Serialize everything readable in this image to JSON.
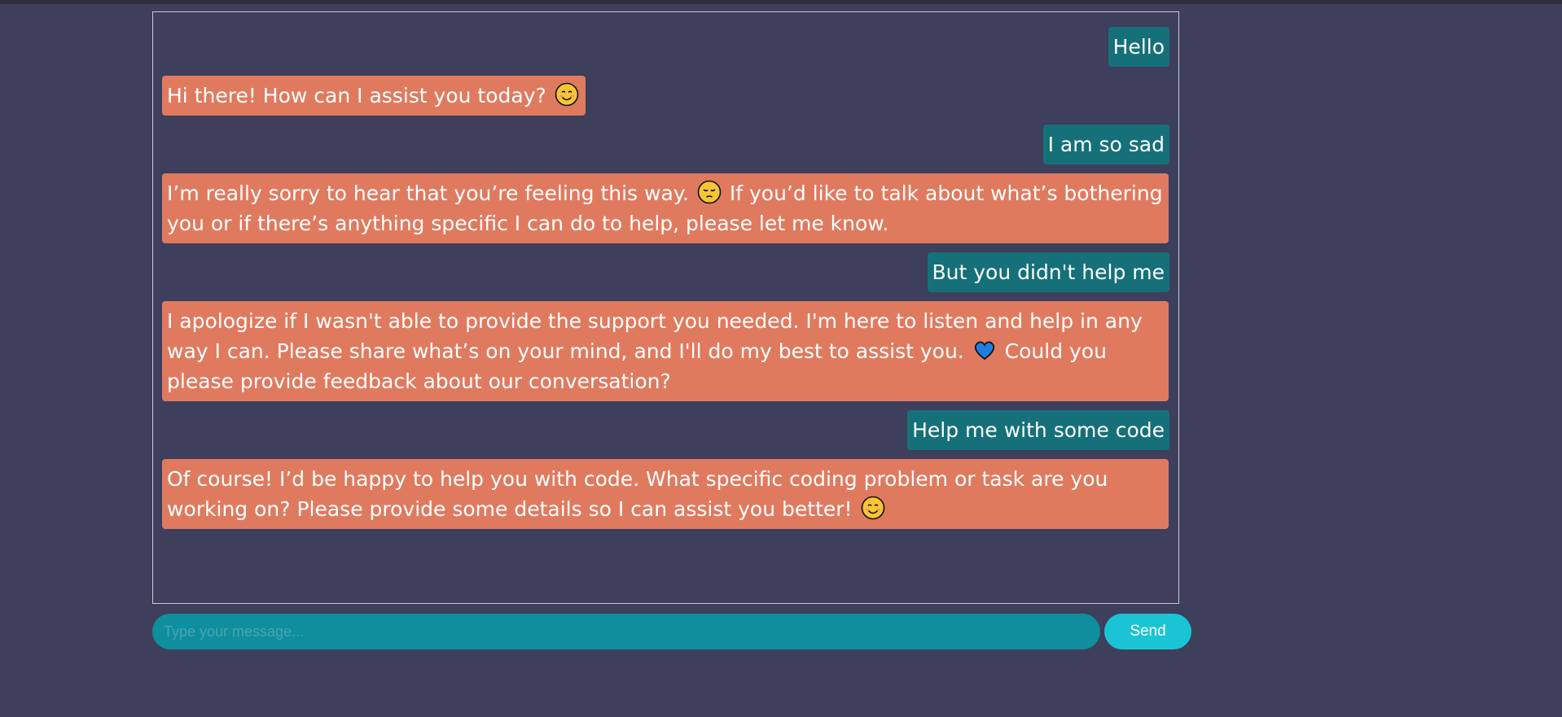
{
  "chat": {
    "messages": [
      {
        "sender": "user",
        "text": "Hello"
      },
      {
        "sender": "bot",
        "parts": [
          {
            "text": "Hi there! How can I assist you today? "
          },
          {
            "emoji": "smiling-face-icon"
          }
        ]
      },
      {
        "sender": "user",
        "text": "I am so sad"
      },
      {
        "sender": "bot",
        "parts": [
          {
            "text": "I’m really sorry to hear that you’re feeling this way. "
          },
          {
            "emoji": "pensive-face-icon"
          },
          {
            "text": " If you’d like to talk about what’s bothering you or if there’s anything specific I can do to help, please let me know."
          }
        ]
      },
      {
        "sender": "user",
        "text": "But you didn't help me"
      },
      {
        "sender": "bot",
        "parts": [
          {
            "text": "I apologize if I wasn't able to provide the support you needed. I'm here to listen and help in any way I can. Please share what’s on your mind, and I'll do my best to assist you. "
          },
          {
            "emoji": "blue-heart-icon"
          },
          {
            "text": " Could you please provide feedback about our conversation?"
          }
        ]
      },
      {
        "sender": "user",
        "text": "Help me with some code"
      },
      {
        "sender": "bot",
        "parts": [
          {
            "text": "Of course! I’d be happy to help you with code. What specific coding problem or task are you working on? Please provide some details so I can assist you better! "
          },
          {
            "emoji": "smiling-face-icon"
          }
        ]
      }
    ]
  },
  "composer": {
    "placeholder": "Type your message...",
    "value": "",
    "send_label": "Send"
  },
  "colors": {
    "background": "#3d3f5c",
    "user_bubble": "#16707a",
    "bot_bubble": "#e07a5f",
    "input_bg": "#0f8e9e",
    "send_bg": "#1ac4d4"
  }
}
